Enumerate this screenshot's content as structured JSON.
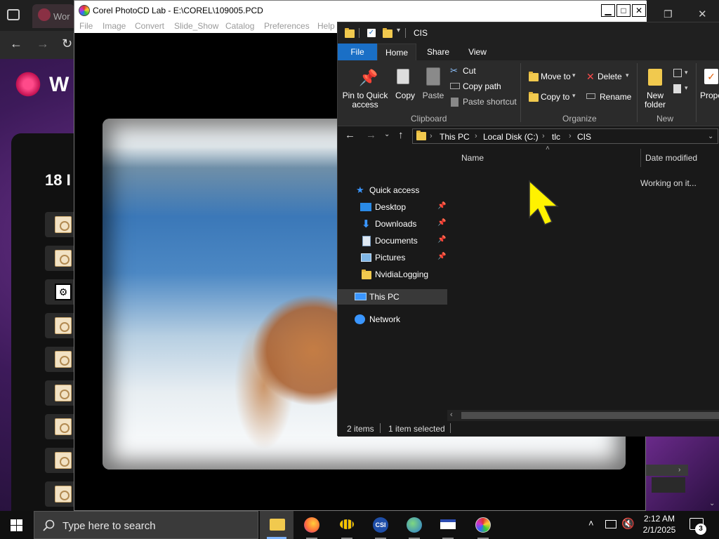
{
  "browser": {
    "tab_title": "Wor",
    "brand_letter": "W",
    "list_heading": "18 I"
  },
  "corel": {
    "title": "Corel PhotoCD Lab - E:\\COREL\\109005.PCD",
    "menu": [
      "File",
      "Image",
      "Convert",
      "Slide_Show",
      "Catalog",
      "Preferences",
      "Help"
    ],
    "minimize_glyph": "▁",
    "maximize_glyph": "□",
    "close_glyph": "✕"
  },
  "explorer": {
    "title": "CIS",
    "ribbon_tabs": [
      "File",
      "Home",
      "Share",
      "View"
    ],
    "clipboard": {
      "pin_label": "Pin to Quick access",
      "copy_label": "Copy",
      "paste_label": "Paste",
      "cut_label": "Cut",
      "copy_path_label": "Copy path",
      "paste_shortcut_label": "Paste shortcut",
      "group_label": "Clipboard"
    },
    "organize": {
      "move_to_label": "Move to",
      "copy_to_label": "Copy to",
      "delete_label": "Delete",
      "rename_label": "Rename",
      "group_label": "Organize"
    },
    "new_group": {
      "new_folder_label": "New folder",
      "group_label": "New"
    },
    "properties_label": "Prope",
    "breadcrumbs": [
      "This PC",
      "Local Disk (C:)",
      "tlc",
      "CIS"
    ],
    "nav": {
      "quick_access": "Quick access",
      "items": [
        "Desktop",
        "Downloads",
        "Documents",
        "Pictures",
        "NvidiaLogging"
      ],
      "this_pc": "This PC",
      "network": "Network"
    },
    "columns": {
      "name": "Name",
      "date_modified": "Date modified"
    },
    "working_text": "Working on it...",
    "status": {
      "items": "2 items",
      "selected": "1 item selected"
    }
  },
  "taskbar": {
    "search_placeholder": "Type here to search",
    "time": "2:12 AM",
    "date": "2/1/2025",
    "notification_count": "3"
  },
  "colors": {
    "accent": "#1a6fc6",
    "folder": "#f1c94e",
    "cursor": "#fff200"
  }
}
